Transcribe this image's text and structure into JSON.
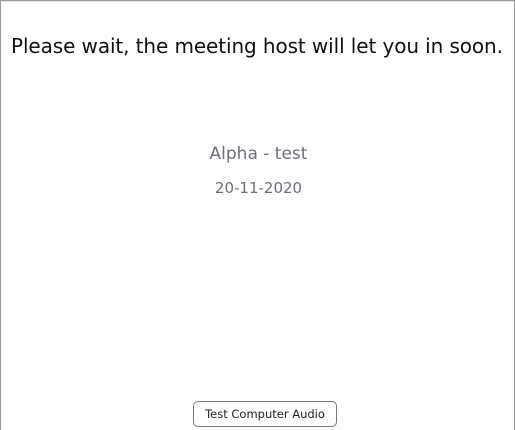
{
  "waiting_room": {
    "message": "Please wait, the meeting host will let you in soon.",
    "meeting_title": "Alpha - test",
    "meeting_date": "20-11-2020"
  },
  "actions": {
    "test_audio_label": "Test Computer Audio"
  }
}
